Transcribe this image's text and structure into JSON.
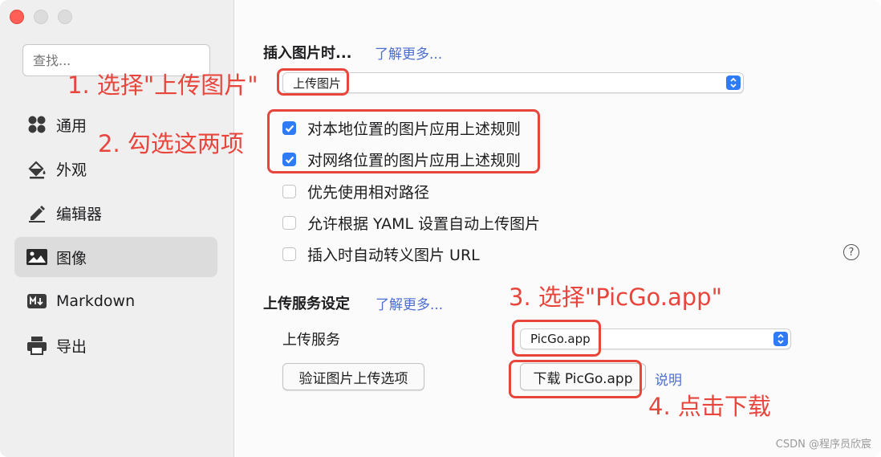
{
  "sidebar": {
    "search_placeholder": "查找...",
    "items": [
      {
        "label": "通用",
        "icon": "grid-icon"
      },
      {
        "label": "外观",
        "icon": "paint-bucket-icon"
      },
      {
        "label": "编辑器",
        "icon": "pencil-icon"
      },
      {
        "label": "图像",
        "icon": "image-icon",
        "active": true
      },
      {
        "label": "Markdown",
        "icon": "markdown-icon"
      },
      {
        "label": "导出",
        "icon": "printer-icon"
      }
    ]
  },
  "image_section": {
    "title": "插入图片时...",
    "learn_more": "了解更多...",
    "select_value": "上传图片",
    "checkboxes": [
      {
        "label": "对本地位置的图片应用上述规则",
        "checked": true
      },
      {
        "label": "对网络位置的图片应用上述规则",
        "checked": true
      },
      {
        "label": "优先使用相对路径",
        "checked": false
      },
      {
        "label": "允许根据 YAML 设置自动上传图片",
        "checked": false
      },
      {
        "label": "插入时自动转义图片 URL",
        "checked": false
      }
    ]
  },
  "upload_section": {
    "title": "上传服务设定",
    "learn_more": "了解更多...",
    "service_label": "上传服务",
    "service_value": "PicGo.app",
    "verify_button": "验证图片上传选项",
    "download_button": "下载 PicGo.app",
    "explain_link": "说明"
  },
  "annotations": {
    "step1": "1. 选择\"上传图片\"",
    "step2": "2. 勾选这两项",
    "step3": "3. 选择\"PicGo.app\"",
    "step4": "4. 点击下载"
  },
  "help_glyph": "?",
  "watermark": "CSDN @程序员欣宸",
  "colors": {
    "accent": "#2f7bf5",
    "annotation": "#e8453c",
    "link": "#4d6ed1"
  }
}
